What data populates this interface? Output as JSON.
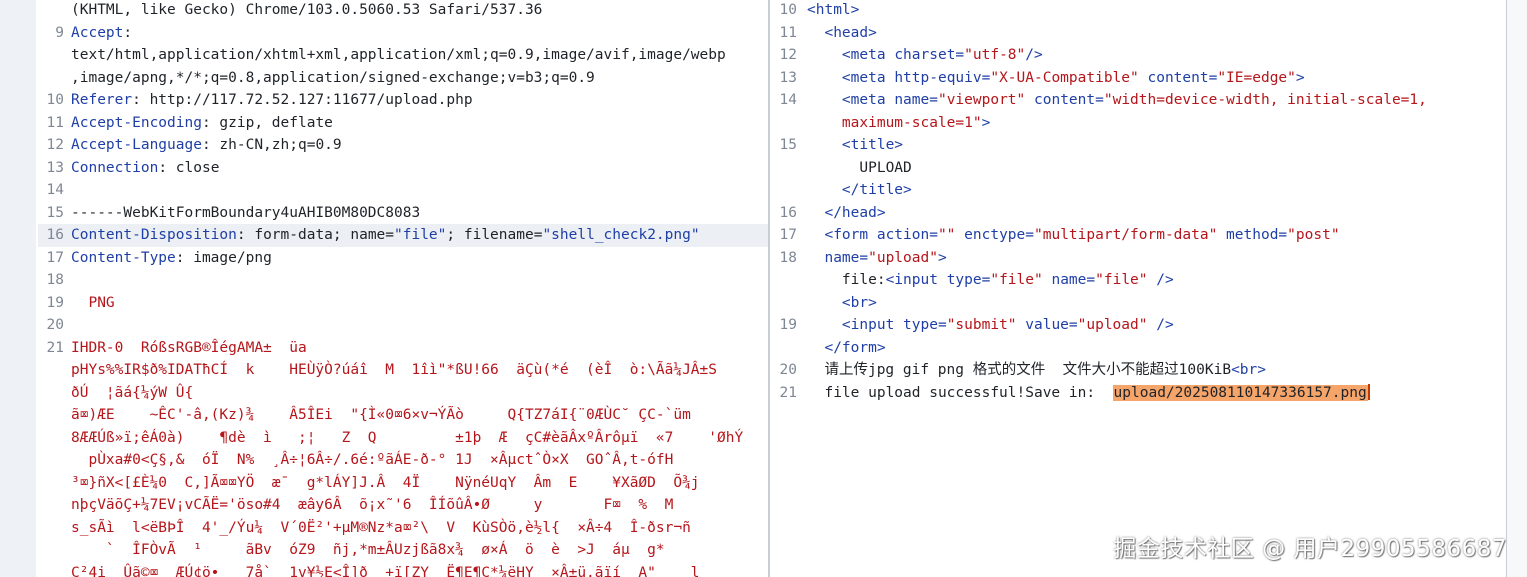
{
  "request_pane": {
    "lines": [
      {
        "num": "",
        "segments": [
          {
            "t": "(KHTML, like Gecko) Chrome/103.0.5060.53 Safari/537.36",
            "c": "txt"
          }
        ]
      },
      {
        "num": "9",
        "segments": [
          {
            "t": "Accept",
            "c": "k"
          },
          {
            "t": ":",
            "c": "txt"
          }
        ]
      },
      {
        "num": "",
        "segments": [
          {
            "t": "text/html,application/xhtml+xml,application/xml;q=0.9,image/avif,image/webp",
            "c": "txt"
          }
        ]
      },
      {
        "num": "",
        "segments": [
          {
            "t": ",image/apng,*/*;q=0.8,application/signed-exchange;v=b3;q=0.9",
            "c": "txt"
          }
        ]
      },
      {
        "num": "10",
        "segments": [
          {
            "t": "Referer",
            "c": "k"
          },
          {
            "t": ": http://117.72.52.127:11677/upload.php",
            "c": "txt"
          }
        ]
      },
      {
        "num": "11",
        "segments": [
          {
            "t": "Accept-Encoding",
            "c": "k"
          },
          {
            "t": ": gzip, deflate",
            "c": "txt"
          }
        ]
      },
      {
        "num": "12",
        "segments": [
          {
            "t": "Accept-Language",
            "c": "k"
          },
          {
            "t": ": zh-CN,zh;q=0.9",
            "c": "txt"
          }
        ]
      },
      {
        "num": "13",
        "segments": [
          {
            "t": "Connection",
            "c": "k"
          },
          {
            "t": ": close",
            "c": "txt"
          }
        ]
      },
      {
        "num": "14",
        "segments": []
      },
      {
        "num": "15",
        "segments": [
          {
            "t": "------WebKitFormBoundary4uAHIB0M80DC8083",
            "c": "txt"
          }
        ]
      },
      {
        "num": "16",
        "hl": true,
        "segments": [
          {
            "t": "Content-Disposition",
            "c": "k"
          },
          {
            "t": ": form-data; name=",
            "c": "txt"
          },
          {
            "t": "\"file\"",
            "c": "sv"
          },
          {
            "t": "; filename=",
            "c": "txt"
          },
          {
            "t": "\"shell_check2.png\"",
            "c": "sv"
          }
        ]
      },
      {
        "num": "17",
        "segments": [
          {
            "t": "Content-Type",
            "c": "k"
          },
          {
            "t": ": image/png",
            "c": "txt"
          }
        ]
      },
      {
        "num": "18",
        "segments": []
      },
      {
        "num": "19",
        "segments": [
          {
            "t": "  PNG",
            "c": "bin"
          }
        ]
      },
      {
        "num": "20",
        "segments": []
      },
      {
        "num": "21",
        "segments": [
          {
            "t": "IHDR-0  RóßsRGB®ÎégAMA±  üa",
            "c": "bin"
          }
        ]
      },
      {
        "num": "",
        "segments": [
          {
            "t": "pHYs%%IR$ð%IDATħCÍ  k    HEÙÿÒ?úáî  M  1îì\"*ßU!66  äÇù(*é  (èÎ  ò:\\Ãã¼JÂ±S",
            "c": "bin"
          }
        ]
      },
      {
        "num": "",
        "segments": [
          {
            "t": "ðÚ  ¦ãá{¼ýW Û{",
            "c": "bin"
          }
        ]
      },
      {
        "num": "",
        "segments": [
          {
            "t": "ã⌧)ÆE    ~ÊC'-â,(Kz)¾    Â5ÎEi  \"{Ì«0⌧6×v¬ÝÃò     Q{TZ7áI{¨0ÆÙC˘ ÇC-`üm",
            "c": "bin"
          }
        ]
      },
      {
        "num": "",
        "segments": [
          {
            "t": "8ÆÆÚß»ï;êÁ0à)    ¶dè  ì   ;¦   Z  Q         ±1þ  Æ  çC#èãÂxºÂrôµï  «7    'ØhÝ",
            "c": "bin"
          }
        ]
      },
      {
        "num": "",
        "segments": [
          {
            "t": "  pÙxa#0<Ç§,&  óÏ  N%  ¸Â÷¦6Â÷/.6é:ºãÁE-ð-° 1J  ×ÂµctˆÒ×X  GOˆÂ,t-ófH",
            "c": "bin"
          }
        ]
      },
      {
        "num": "",
        "segments": [
          {
            "t": "³⌧}ñX<[£È¼0  C,]Ã⌧⌧YÖ  æ¯  g*lÁY]J.Â  4Ï    NÿnéUqY  Âm  E    ¥XãØD  Õ¾j",
            "c": "bin"
          }
        ]
      },
      {
        "num": "",
        "segments": [
          {
            "t": "nþçVäõÇ+¼7EV¡vCÃË='öso#4  æây6Â  õ¡x˜'6  ÎÍõûÂ•Ø     y       F⌧  %  M",
            "c": "bin"
          }
        ]
      },
      {
        "num": "",
        "segments": [
          {
            "t": "s_sÃì  l<ëBÞÎ  4'_/Ýu¼  V´0Ë²'+µM®Nz*a⌧²\\  V  KùSÒö,è½l{  ×Â÷4  Î-ðsr¬ñ",
            "c": "bin"
          }
        ]
      },
      {
        "num": "",
        "segments": [
          {
            "t": "    `  ÎFÒvÃ  ¹     ãBv  óZ9  ñj,*m±ÂUzjßã8x¾  ø×Á  ö  è  >J  áµ  g*",
            "c": "bin"
          }
        ]
      },
      {
        "num": "",
        "segments": [
          {
            "t": "C²4i  Ûã©⌧  ÆÚ¢ö•   7å`  1v¥½E<Î]ð  +ï[ZY  Ë¶E¶C*¼ëHY  ×Â±ü.ãïí  A\"    l",
            "c": "bin"
          }
        ]
      }
    ]
  },
  "response_pane": {
    "lines": [
      {
        "num": "10",
        "segments": [
          {
            "t": "<html>",
            "c": "tag"
          }
        ]
      },
      {
        "num": "11",
        "segments": [
          {
            "t": "  <head>",
            "c": "tag"
          }
        ]
      },
      {
        "num": "12",
        "segments": [
          {
            "t": "    <meta ",
            "c": "tag"
          },
          {
            "t": "charset=",
            "c": "attr"
          },
          {
            "t": "\"utf-8\"",
            "c": "val"
          },
          {
            "t": "/>",
            "c": "tag"
          }
        ]
      },
      {
        "num": "13",
        "segments": [
          {
            "t": "    <meta ",
            "c": "tag"
          },
          {
            "t": "http-equiv=",
            "c": "attr"
          },
          {
            "t": "\"X-UA-Compatible\"",
            "c": "val"
          },
          {
            "t": " content=",
            "c": "attr"
          },
          {
            "t": "\"IE=edge\"",
            "c": "val"
          },
          {
            "t": ">",
            "c": "tag"
          }
        ]
      },
      {
        "num": "14",
        "segments": [
          {
            "t": "    <meta ",
            "c": "tag"
          },
          {
            "t": "name=",
            "c": "attr"
          },
          {
            "t": "\"viewport\"",
            "c": "val"
          },
          {
            "t": " content=",
            "c": "attr"
          },
          {
            "t": "\"width=device-width, initial-scale=1,",
            "c": "val"
          }
        ]
      },
      {
        "num": "",
        "segments": [
          {
            "t": "    maximum-scale=1\"",
            "c": "val"
          },
          {
            "t": ">",
            "c": "tag"
          }
        ]
      },
      {
        "num": "15",
        "segments": [
          {
            "t": "    <title>",
            "c": "tag"
          }
        ]
      },
      {
        "num": "",
        "segments": [
          {
            "t": "      UPLOAD",
            "c": "txt"
          }
        ]
      },
      {
        "num": "",
        "segments": [
          {
            "t": "    </title>",
            "c": "tag"
          }
        ]
      },
      {
        "num": "16",
        "segments": [
          {
            "t": "  </head>",
            "c": "tag"
          }
        ]
      },
      {
        "num": "17",
        "segments": [
          {
            "t": "  <form ",
            "c": "tag"
          },
          {
            "t": "action=",
            "c": "attr"
          },
          {
            "t": "\"\"",
            "c": "val"
          },
          {
            "t": " enctype=",
            "c": "attr"
          },
          {
            "t": "\"multipart/form-data\"",
            "c": "val"
          },
          {
            "t": " method=",
            "c": "attr"
          },
          {
            "t": "\"post\"",
            "c": "val"
          }
        ]
      },
      {
        "num": "18",
        "segments": [
          {
            "t": "  name=",
            "c": "attr"
          },
          {
            "t": "\"upload\"",
            "c": "val"
          },
          {
            "t": ">",
            "c": "tag"
          }
        ]
      },
      {
        "num": "",
        "segments": [
          {
            "t": "    file:",
            "c": "txt"
          },
          {
            "t": "<input ",
            "c": "tag"
          },
          {
            "t": "type=",
            "c": "attr"
          },
          {
            "t": "\"file\"",
            "c": "val"
          },
          {
            "t": " name=",
            "c": "attr"
          },
          {
            "t": "\"file\"",
            "c": "val"
          },
          {
            "t": " />",
            "c": "tag"
          }
        ]
      },
      {
        "num": "",
        "segments": [
          {
            "t": "    <br>",
            "c": "tag"
          }
        ]
      },
      {
        "num": "19",
        "segments": [
          {
            "t": "    <input ",
            "c": "tag"
          },
          {
            "t": "type=",
            "c": "attr"
          },
          {
            "t": "\"submit\"",
            "c": "val"
          },
          {
            "t": " value=",
            "c": "attr"
          },
          {
            "t": "\"upload\"",
            "c": "val"
          },
          {
            "t": " />",
            "c": "tag"
          }
        ]
      },
      {
        "num": "",
        "segments": [
          {
            "t": "  </form>",
            "c": "tag"
          }
        ]
      },
      {
        "num": "20",
        "segments": [
          {
            "t": "  请上传jpg gif png 格式的文件  文件大小不能超过100KiB",
            "c": "txt"
          },
          {
            "t": "<br>",
            "c": "tag"
          }
        ]
      },
      {
        "num": "21",
        "segments": [
          {
            "t": "  file upload successful!Save in:  ",
            "c": "txt"
          },
          {
            "t": "upload/20250811014733615 7.png",
            "c": "mark"
          }
        ]
      }
    ]
  },
  "watermark": "掘金技术社区 @ 用户2990558668 7"
}
